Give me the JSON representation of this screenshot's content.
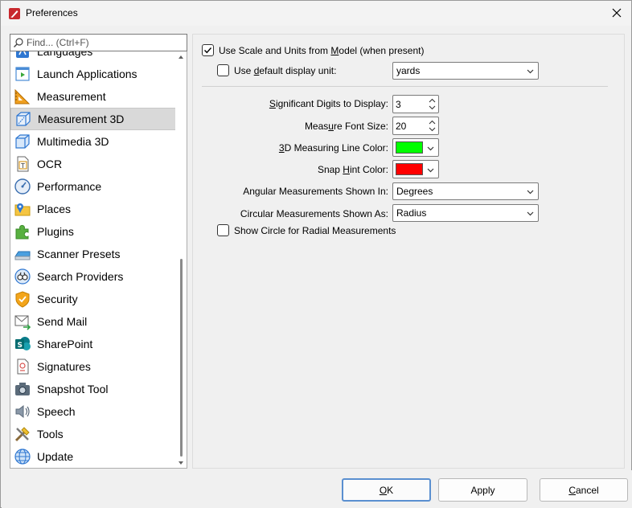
{
  "window": {
    "title": "Preferences",
    "app_icon": "pdf-app-icon",
    "close_icon": "close-icon"
  },
  "sidebar": {
    "search_placeholder": "Find... (Ctrl+F)",
    "items": [
      {
        "label": "Languages",
        "icon": "languages-icon"
      },
      {
        "label": "Launch Applications",
        "icon": "launch-applications-icon"
      },
      {
        "label": "Measurement",
        "icon": "measurement-icon"
      },
      {
        "label": "Measurement 3D",
        "icon": "measurement-3d-icon",
        "selected": true
      },
      {
        "label": "Multimedia 3D",
        "icon": "multimedia-3d-icon"
      },
      {
        "label": "OCR",
        "icon": "ocr-icon"
      },
      {
        "label": "Performance",
        "icon": "performance-icon"
      },
      {
        "label": "Places",
        "icon": "places-icon"
      },
      {
        "label": "Plugins",
        "icon": "plugins-icon"
      },
      {
        "label": "Scanner Presets",
        "icon": "scanner-icon"
      },
      {
        "label": "Search Providers",
        "icon": "search-providers-icon"
      },
      {
        "label": "Security",
        "icon": "security-icon"
      },
      {
        "label": "Send Mail",
        "icon": "send-mail-icon"
      },
      {
        "label": "SharePoint",
        "icon": "sharepoint-icon"
      },
      {
        "label": "Signatures",
        "icon": "signatures-icon"
      },
      {
        "label": "Snapshot Tool",
        "icon": "snapshot-icon"
      },
      {
        "label": "Speech",
        "icon": "speech-icon"
      },
      {
        "label": "Tools",
        "icon": "tools-icon"
      },
      {
        "label": "Update",
        "icon": "update-icon"
      }
    ]
  },
  "settings": {
    "use_scale_pre": "Use Scale and Units from ",
    "use_scale_u": "M",
    "use_scale_post": "odel (when present)",
    "use_scale_checked": true,
    "default_unit_pre": "Use ",
    "default_unit_u": "d",
    "default_unit_post": "efault display unit:",
    "default_unit_checked": false,
    "default_unit_value": "yards",
    "sig_digits_pre": "",
    "sig_digits_u": "S",
    "sig_digits_post": "ignificant Digits to Display:",
    "sig_digits_value": "3",
    "font_size_pre": "Meas",
    "font_size_u": "u",
    "font_size_post": "re Font Size:",
    "font_size_value": "20",
    "line_color_pre": "",
    "line_color_u": "3",
    "line_color_post": "D Measuring Line Color:",
    "line_color": "#00ff00",
    "snap_color_pre": "Snap ",
    "snap_color_u": "H",
    "snap_color_post": "int Color:",
    "snap_color": "#ff0000",
    "angular_label": "Angular Measurements Shown In:",
    "angular_value": "Degrees",
    "circular_label": "Circular Measurements Shown As:",
    "circular_value": "Radius",
    "show_circle_label": "Show Circle for Radial Measurements",
    "show_circle_checked": false
  },
  "buttons": {
    "ok_u": "O",
    "ok_post": "K",
    "apply": "Apply",
    "cancel_u": "C",
    "cancel_post": "ancel"
  }
}
